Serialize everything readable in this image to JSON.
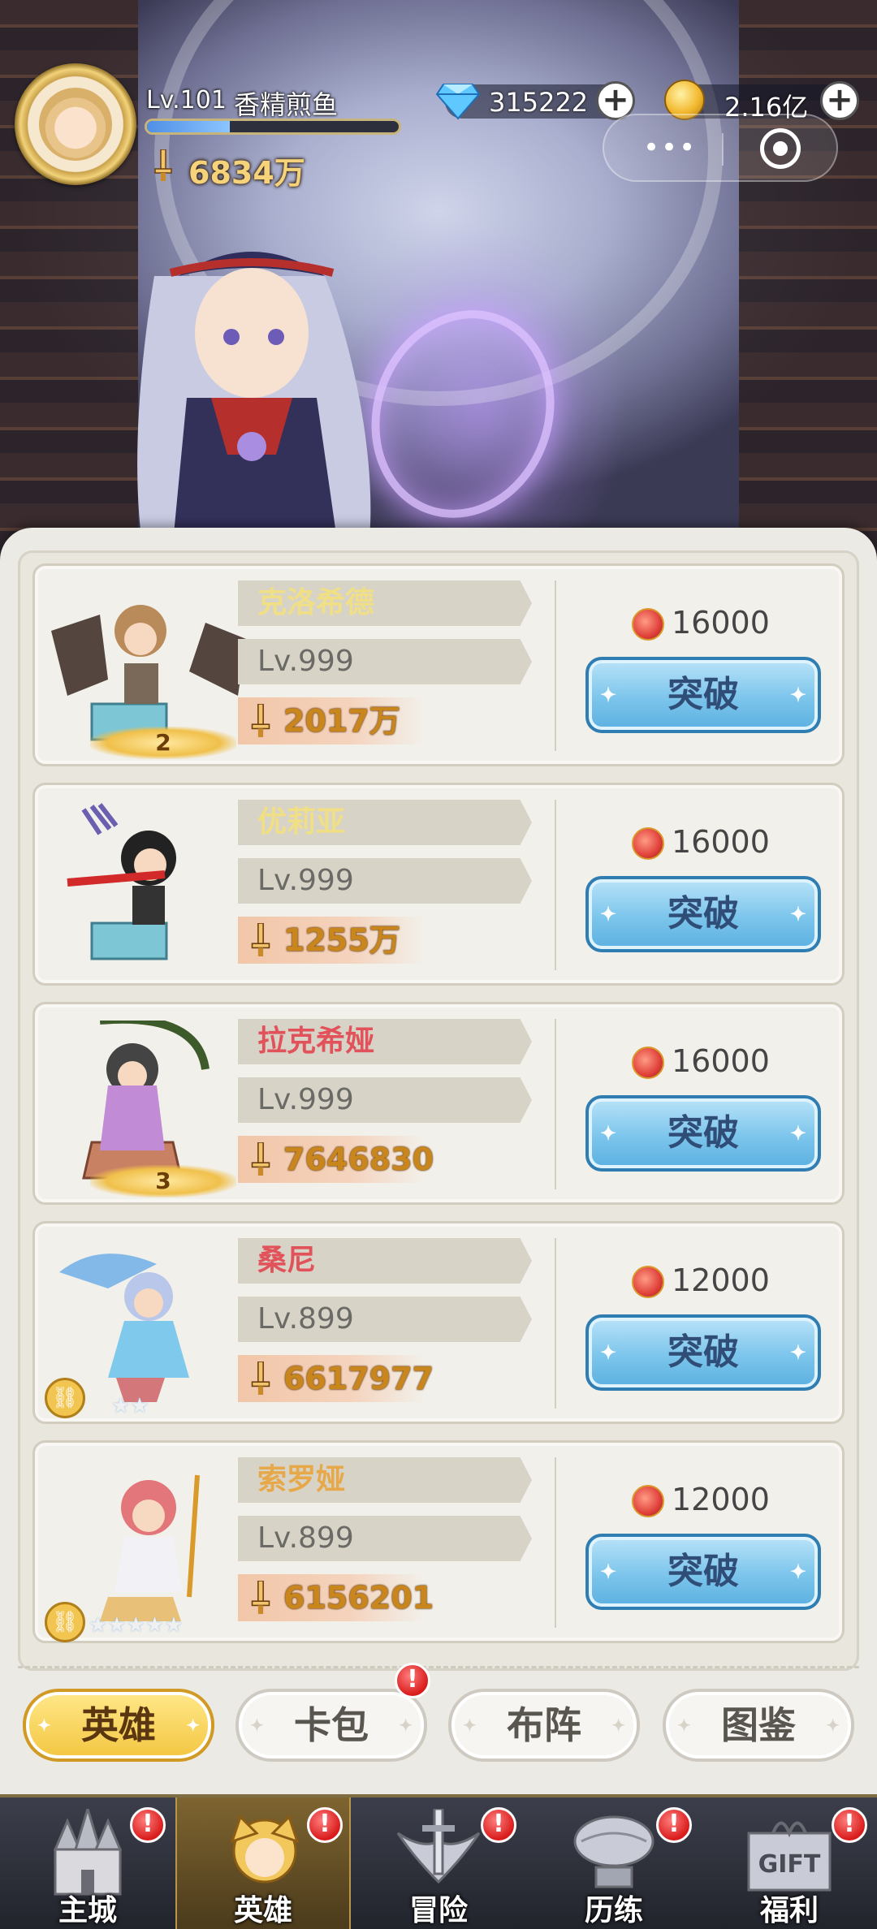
{
  "header": {
    "level_text": "Lv.101",
    "player_name": "香精煎鱼",
    "exp_fraction": 0.33,
    "combat_power": "6834万",
    "gems": "315222",
    "gold": "2.16亿",
    "capsule_more": "•••"
  },
  "heroes": [
    {
      "name": "克洛希德",
      "name_color": "#f1df86",
      "level": "Lv.999",
      "power": "2017万",
      "cost": "16000",
      "button": "突破",
      "rank": "2"
    },
    {
      "name": "优莉亚",
      "name_color": "#f1df86",
      "level": "Lv.999",
      "power": "1255万",
      "cost": "16000",
      "button": "突破"
    },
    {
      "name": "拉克希娅",
      "name_color": "#e1525a",
      "level": "Lv.999",
      "power": "7646830",
      "cost": "16000",
      "button": "突破",
      "rank": "3"
    },
    {
      "name": "桑尼",
      "name_color": "#e1525a",
      "level": "Lv.899",
      "power": "6617977",
      "cost": "12000",
      "button": "突破",
      "stars": "★★"
    },
    {
      "name": "索罗娅",
      "name_color": "#e7a84a",
      "level": "Lv.899",
      "power": "6156201",
      "cost": "12000",
      "button": "突破",
      "stars": "★★★★★"
    }
  ],
  "tabs": [
    {
      "label": "英雄",
      "active": true
    },
    {
      "label": "卡包",
      "badge": "!"
    },
    {
      "label": "布阵"
    },
    {
      "label": "图鉴"
    }
  ],
  "bottom_nav": [
    {
      "label": "主城",
      "icon": "castle-icon",
      "badge": "!"
    },
    {
      "label": "英雄",
      "icon": "hero-icon",
      "badge": "!",
      "active": true
    },
    {
      "label": "冒险",
      "icon": "sword-shield-icon",
      "badge": "!"
    },
    {
      "label": "历练",
      "icon": "airship-icon",
      "badge": "!"
    },
    {
      "label": "福利",
      "icon": "gift-icon",
      "badge": "!"
    }
  ]
}
